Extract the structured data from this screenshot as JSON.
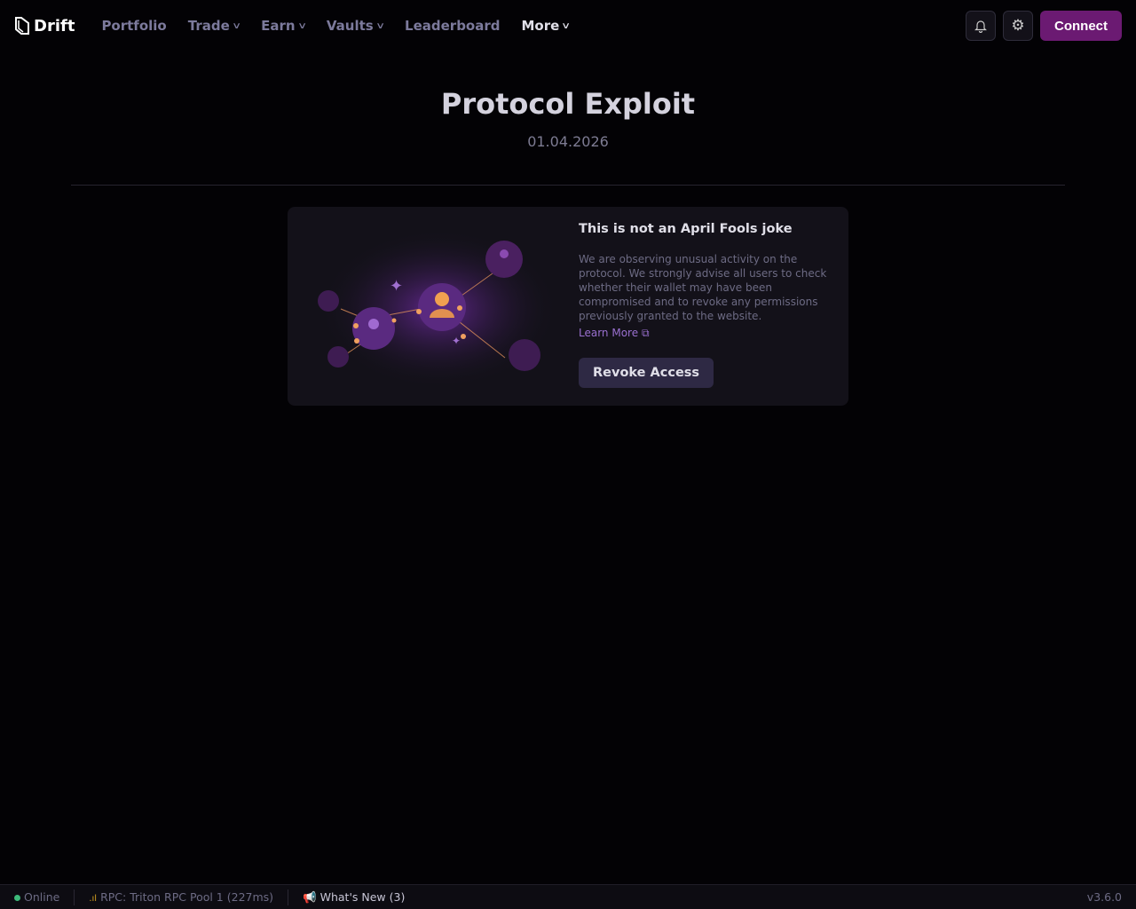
{
  "nav": {
    "logo": "Drift",
    "items": [
      {
        "label": "Portfolio"
      },
      {
        "label": "Trade"
      },
      {
        "label": "Earn"
      },
      {
        "label": "Vaults"
      },
      {
        "label": "Leaderboard"
      },
      {
        "label": "More"
      }
    ],
    "connect": "Connect"
  },
  "page": {
    "title": "Protocol Exploit",
    "date": "01.04.2026"
  },
  "card": {
    "title": "This is not an April Fools joke",
    "body": "We are observing unusual activity on the protocol. We strongly advise all users to check whether their wallet may have been compromised and to revoke any permissions previously granted to the website.",
    "learn_more": "Learn More",
    "button": "Revoke Access"
  },
  "footer": {
    "status": "Online",
    "rpc": "RPC: Triton RPC Pool 1 (227ms)",
    "whats_new": "What's New (3)",
    "version": "v3.6.0"
  }
}
